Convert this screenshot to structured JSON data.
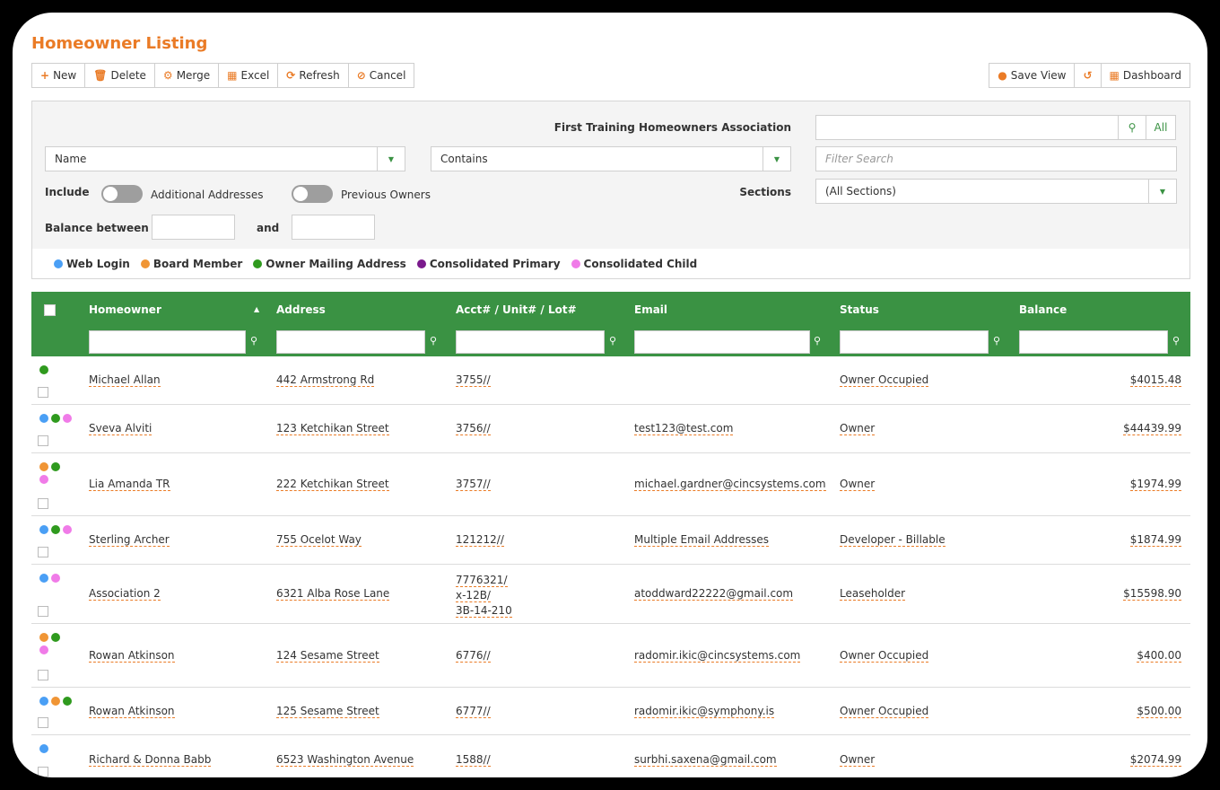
{
  "page": {
    "title": "Homeowner Listing"
  },
  "colors": {
    "accent": "#ea7b26",
    "header_green": "#3a9243",
    "web_login": "#4a9ff5",
    "board_member": "#f09535",
    "owner_mailing": "#2f9a1e",
    "consolidated_primary": "#7a1a8c",
    "consolidated_child": "#f07be8"
  },
  "toolbar": {
    "new": {
      "icon": "plus-icon",
      "label": "New"
    },
    "delete": {
      "icon": "trash-icon",
      "label": "Delete"
    },
    "merge": {
      "icon": "cogs-icon",
      "label": "Merge"
    },
    "excel": {
      "icon": "table-icon",
      "label": "Excel"
    },
    "refresh": {
      "icon": "refresh-icon",
      "label": "Refresh"
    },
    "cancel": {
      "icon": "ban-icon",
      "label": "Cancel"
    },
    "save_view": {
      "icon": "user-icon",
      "label": "Save View"
    },
    "reset": {
      "icon": "undo-icon"
    },
    "dashboard": {
      "icon": "grid-icon",
      "label": "Dashboard"
    }
  },
  "filters": {
    "association_label": "First Training Homeowners Association",
    "association_value": "",
    "all_label": "All",
    "field_select": "Name",
    "operator_select": "Contains",
    "filter_search_placeholder": "Filter Search",
    "include_label": "Include",
    "additional_addresses_label": "Additional Addresses",
    "additional_addresses_on": false,
    "previous_owners_label": "Previous Owners",
    "previous_owners_on": false,
    "sections_label": "Sections",
    "sections_value": "(All Sections)",
    "balance_between_label": "Balance between",
    "and_label": "and",
    "balance_min": "",
    "balance_max": ""
  },
  "legend": [
    {
      "label": "Web Login",
      "color": "#4a9ff5"
    },
    {
      "label": "Board Member",
      "color": "#f09535"
    },
    {
      "label": "Owner Mailing Address",
      "color": "#2f9a1e"
    },
    {
      "label": "Consolidated Primary",
      "color": "#7a1a8c"
    },
    {
      "label": "Consolidated Child",
      "color": "#f07be8"
    }
  ],
  "grid": {
    "columns": [
      "Homeowner",
      "Address",
      "Acct# / Unit# / Lot#",
      "Email",
      "Status",
      "Balance"
    ],
    "sort_column": "Homeowner",
    "sort_dir": "asc",
    "rows": [
      {
        "dots": [
          "#2f9a1e"
        ],
        "homeowner": "Michael Allan",
        "address": "442 Armstrong Rd",
        "acct": [
          "3755//"
        ],
        "email": "",
        "status": "Owner Occupied",
        "balance": "$4015.48"
      },
      {
        "dots": [
          "#4a9ff5",
          "#2f9a1e",
          "#f07be8"
        ],
        "homeowner": "Sveva  Alviti",
        "address": "123 Ketchikan Street",
        "acct": [
          "3756//"
        ],
        "email": "test123@test.com",
        "status": "Owner",
        "balance": "$44439.99"
      },
      {
        "dots": [
          "#f09535",
          "#2f9a1e",
          "#f07be8"
        ],
        "homeowner": "Lia  Amanda TR",
        "address": "222 Ketchikan Street",
        "acct": [
          "3757//"
        ],
        "email": "michael.gardner@cincsystems.com",
        "status": "Owner",
        "balance": "$1974.99"
      },
      {
        "dots": [
          "#4a9ff5",
          "#2f9a1e",
          "#f07be8"
        ],
        "homeowner": "Sterling Archer",
        "address": "755 Ocelot Way",
        "acct": [
          "121212//"
        ],
        "email": "Multiple Email Addresses",
        "status": "Developer - Billable",
        "balance": "$1874.99"
      },
      {
        "dots": [
          "#4a9ff5",
          "#f07be8"
        ],
        "homeowner": " Association 2",
        "address": "6321 Alba Rose Lane",
        "acct": [
          "7776321/",
          "x-12B/",
          "3B-14-210"
        ],
        "email": "atoddward22222@gmail.com",
        "status": "Leaseholder",
        "balance": "$15598.90"
      },
      {
        "dots": [
          "#f09535",
          "#2f9a1e",
          "#f07be8"
        ],
        "homeowner": "Rowan Atkinson",
        "address": "124 Sesame Street",
        "acct": [
          "6776//"
        ],
        "email": "radomir.ikic@cincsystems.com",
        "status": "Owner Occupied",
        "balance": "$400.00"
      },
      {
        "dots": [
          "#4a9ff5",
          "#f09535",
          "#2f9a1e"
        ],
        "homeowner": "Rowan Atkinson",
        "address": "125 Sesame Street",
        "acct": [
          "6777//"
        ],
        "email": "radomir.ikic@symphony.is",
        "status": "Owner Occupied",
        "balance": "$500.00"
      },
      {
        "dots": [
          "#4a9ff5"
        ],
        "homeowner": "Richard & Donna Babb",
        "address": "6523 Washington Avenue",
        "acct": [
          "1588//"
        ],
        "email": "surbhi.saxena@gmail.com",
        "status": "Owner",
        "balance": "$2074.99"
      }
    ]
  }
}
